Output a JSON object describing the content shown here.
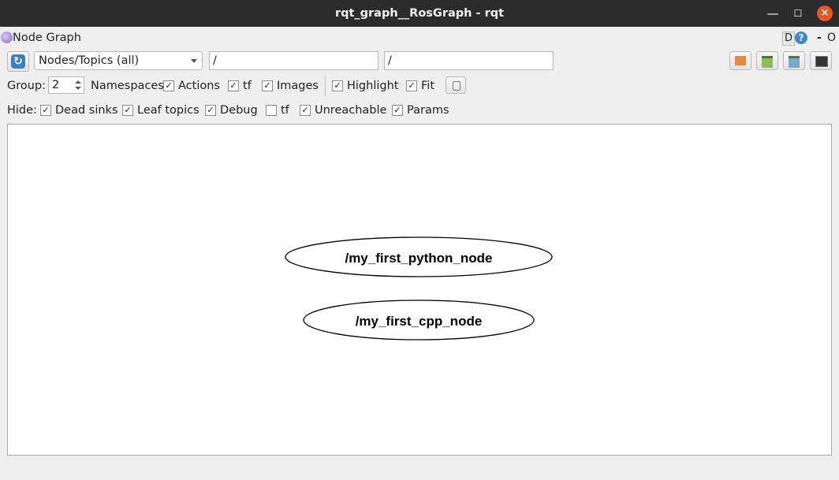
{
  "window": {
    "title": "rqt_graph__RosGraph - rqt"
  },
  "plugin": {
    "title": "Node Graph",
    "dock_d": "D",
    "dock_help": "?",
    "dock_dash": "-",
    "dock_o": "O"
  },
  "toolbar": {
    "mode_select": "Nodes/Topics (all)",
    "filter_1": "/",
    "filter_2": "/"
  },
  "options": {
    "group_label": "Group:",
    "group_value": "2",
    "namespaces": {
      "label": "Namespaces"
    },
    "actions": {
      "label": "Actions",
      "checked": true
    },
    "tf": {
      "label": "tf",
      "checked": true
    },
    "images": {
      "label": "Images",
      "checked": true
    },
    "highlight": {
      "label": "Highlight",
      "checked": true
    },
    "fit": {
      "label": "Fit",
      "checked": true
    }
  },
  "hide": {
    "label": "Hide:",
    "dead_sinks": {
      "label": "Dead sinks",
      "checked": true
    },
    "leaf_topics": {
      "label": "Leaf topics",
      "checked": true
    },
    "debug": {
      "label": "Debug",
      "checked": true
    },
    "tf": {
      "label": "tf",
      "checked": false
    },
    "unreachable": {
      "label": "Unreachable",
      "checked": true
    },
    "params": {
      "label": "Params",
      "checked": true
    }
  },
  "graph": {
    "nodes": [
      {
        "label": "/my_first_python_node"
      },
      {
        "label": "/my_first_cpp_node"
      }
    ]
  },
  "colors": {
    "titlebar": "#2c2c2c",
    "close": "#e95420",
    "accent": "#3a7ec3"
  }
}
